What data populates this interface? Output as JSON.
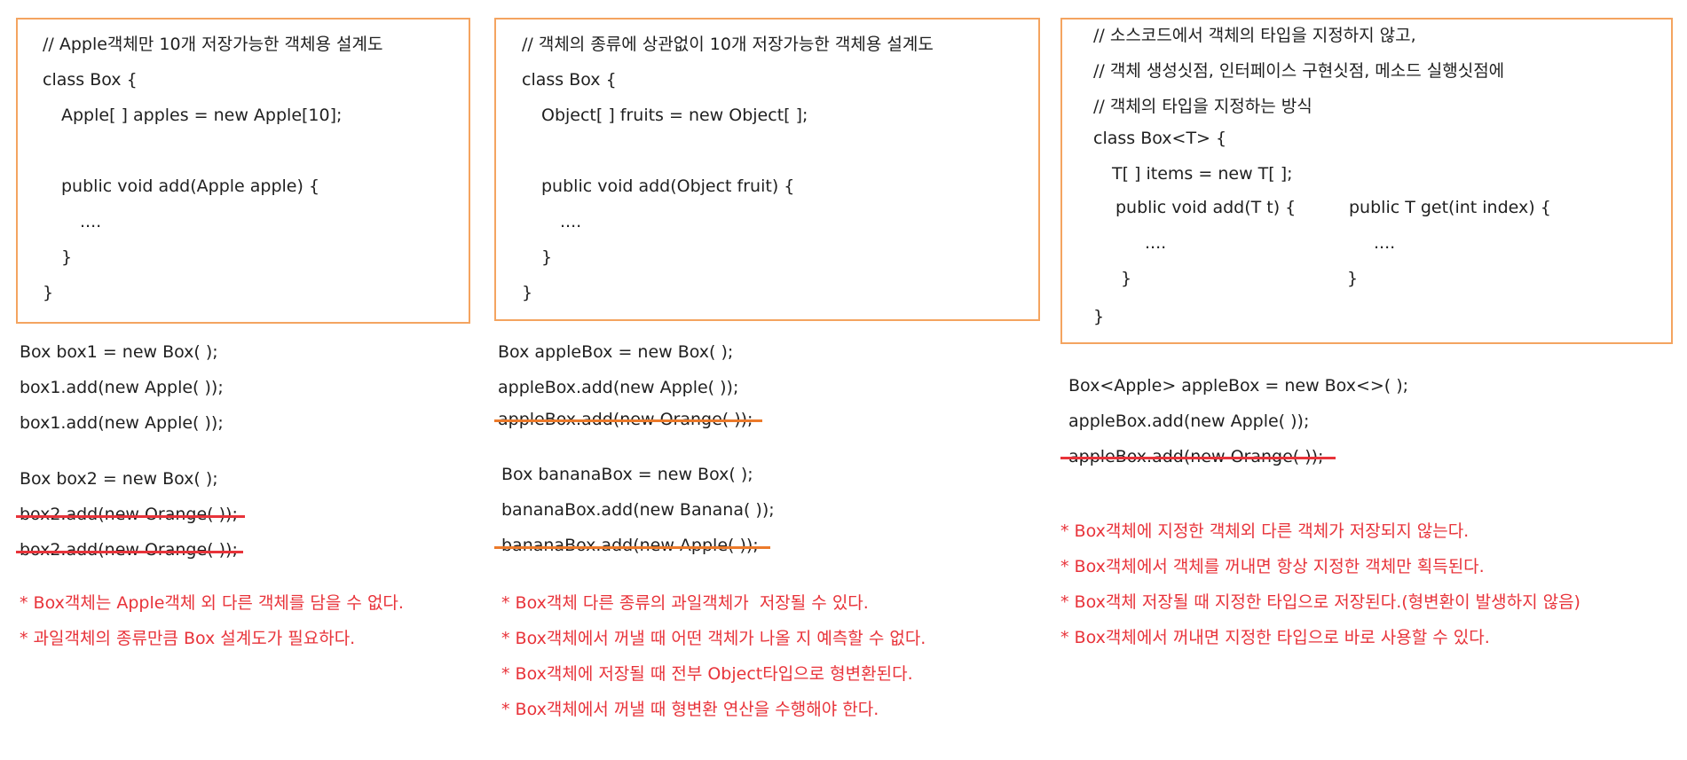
{
  "panels": [
    {
      "code": [
        "// Apple객체만 10개 저장가능한 객체용 설계도",
        "class Box {",
        "Apple[ ] apples = new Apple[10];",
        "public void add(Apple apple) {",
        "....",
        "}",
        "}"
      ],
      "usage": [
        "Box box1 = new Box( );",
        "box1.add(new Apple( ));",
        "box1.add(new Apple( ));",
        "Box box2 = new Box( );",
        "box2.add(new Orange( ));",
        "box2.add(new Orange( ));"
      ],
      "notes": [
        "* Box객체는 Apple객체 외 다른 객체를 담을 수 없다.",
        "* 과일객체의 종류만큼 Box 설계도가 필요하다."
      ]
    },
    {
      "code": [
        "// 객체의 종류에 상관없이 10개 저장가능한 객체용 설계도",
        "class Box {",
        "Object[ ] fruits = new Object[ ];",
        "public void add(Object fruit) {",
        "....",
        "}",
        "}"
      ],
      "usage": [
        "Box appleBox = new Box( );",
        "appleBox.add(new Apple( ));",
        "appleBox.add(new Orange( ));",
        "Box bananaBox = new Box( );",
        "bananaBox.add(new Banana( ));",
        "bananaBox.add(new Apple( ));"
      ],
      "notes": [
        "* Box객체 다른 종류의 과일객체가  저장될 수 있다.",
        "* Box객체에서 꺼낼 때 어떤 객체가 나올 지 예측할 수 없다.",
        "* Box객체에 저장될 때 전부 Object타입으로 형변환된다.",
        "* Box객체에서 꺼낼 때 형변환 연산을 수행해야 한다."
      ]
    },
    {
      "code": [
        "// 소스코드에서 객체의 타입을 지정하지 않고,",
        "// 객체 생성싯점, 인터페이스 구현싯점, 메소드 실행싯점에",
        "// 객체의 타입을 지정하는 방식",
        "class Box<T> {",
        "T[ ] items = new T[ ];",
        "public void add(T t) {",
        "public T get(int index) {",
        "....",
        "....",
        "}",
        "}",
        "}"
      ],
      "usage": [
        "Box<Apple> appleBox = new Box<>( );",
        "appleBox.add(new Apple( ));",
        "appleBox.add(new Orange( ));"
      ],
      "notes": [
        "* Box객체에 지정한 객체외 다른 객체가 저장되지 않는다.",
        "* Box객체에서 객체를 꺼내면 항상 지정한 객체만 획득된다.",
        "* Box객체 저장될 때 지정한 타입으로 저장된다.(형변환이 발생하지 않음)",
        "* Box객체에서 꺼내면 지정한 타입으로 바로 사용할 수 있다."
      ]
    }
  ],
  "colors": {
    "border": "#f4a460",
    "note": "#e8333a",
    "strike_orange": "#ec7a2a",
    "strike_red": "#e8333a"
  }
}
